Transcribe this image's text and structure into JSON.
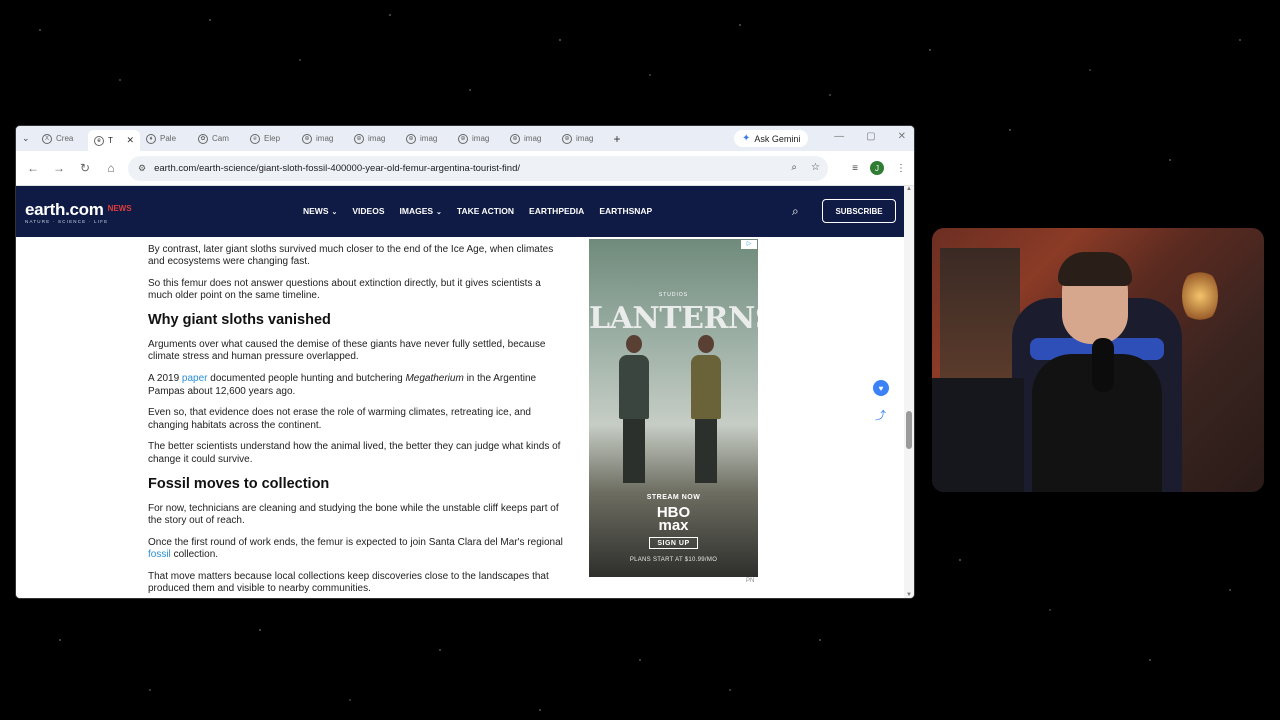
{
  "browser": {
    "tabs": [
      {
        "label": "Crea",
        "icon": "x-icon",
        "glyph": "X"
      },
      {
        "label": "T",
        "icon": "earth-icon",
        "glyph": "e",
        "active": true
      },
      {
        "label": "Pale",
        "icon": "fossil-icon",
        "glyph": "♦"
      },
      {
        "label": "Cam",
        "icon": "paw-icon",
        "glyph": "✿"
      },
      {
        "label": "Elep",
        "icon": "elephant-icon",
        "glyph": "e"
      },
      {
        "label": "imag",
        "icon": "image-search-icon",
        "glyph": "⊕"
      },
      {
        "label": "imag",
        "icon": "image-search-icon",
        "glyph": "⊕"
      },
      {
        "label": "imag",
        "icon": "image-search-icon",
        "glyph": "⊕"
      },
      {
        "label": "imag",
        "icon": "image-search-icon",
        "glyph": "⊕"
      },
      {
        "label": "imag",
        "icon": "image-search-icon",
        "glyph": "⊕"
      },
      {
        "label": "imag",
        "icon": "image-search-icon",
        "glyph": "⊕"
      }
    ],
    "new_tab": "+",
    "gemini_label": "Ask Gemini",
    "url": "earth.com/earth-science/giant-sloth-fossil-400000-year-old-femur-argentina-tourist-find/",
    "profile_initial": "J"
  },
  "site": {
    "logo": "earth.com",
    "logo_news": "NEWS",
    "logo_tagline": "NATURE · SCIENCE · LIFE",
    "nav": [
      {
        "label": "NEWS",
        "dropdown": true
      },
      {
        "label": "VIDEOS",
        "dropdown": false
      },
      {
        "label": "IMAGES",
        "dropdown": true
      },
      {
        "label": "TAKE ACTION",
        "dropdown": false
      },
      {
        "label": "EARTHPEDIA",
        "dropdown": false
      },
      {
        "label": "EARTHSNAP",
        "dropdown": false
      }
    ],
    "subscribe": "SUBSCRIBE"
  },
  "article": {
    "p1": "By contrast, later giant sloths survived much closer to the end of the Ice Age, when climates and ecosystems were changing fast.",
    "p2": "So this femur does not answer questions about extinction directly, but it gives scientists a much older point on the same timeline.",
    "h1": "Why giant sloths vanished",
    "p3": "Arguments over what caused the demise of these giants have never fully settled, because climate stress and human pressure overlapped.",
    "p4_a": "A 2019 ",
    "p4_link": "paper",
    "p4_b": " documented people hunting and butchering ",
    "p4_em": "Megatherium",
    "p4_c": " in the Argentine Pampas about 12,600 years ago.",
    "p5": "Even so, that evidence does not erase the role of warming climates, retreating ice, and changing habitats across the continent.",
    "p6": "The better scientists understand how the animal lived, the better they can judge what kinds of change it could survive.",
    "h2": "Fossil moves to collection",
    "p7": "For now, technicians are cleaning and studying the bone while the unstable cliff keeps part of the story out of reach.",
    "p8_a": "Once the first round of work ends, the femur is expected to join Santa Clara del Mar's regional ",
    "p8_link": "fossil",
    "p8_b": " collection.",
    "p9": "That move matters because local collections keep discoveries close to the landscapes that produced them and visible to nearby communities."
  },
  "ad": {
    "studio": "STUDIOS",
    "title": "LANTERNS",
    "stream_now": "STREAM NOW",
    "hbo_line1": "HBO",
    "hbo_line2": "max",
    "signup": "SIGN UP",
    "plans": "PLANS START AT $10.99/MO",
    "pn": "PN"
  }
}
